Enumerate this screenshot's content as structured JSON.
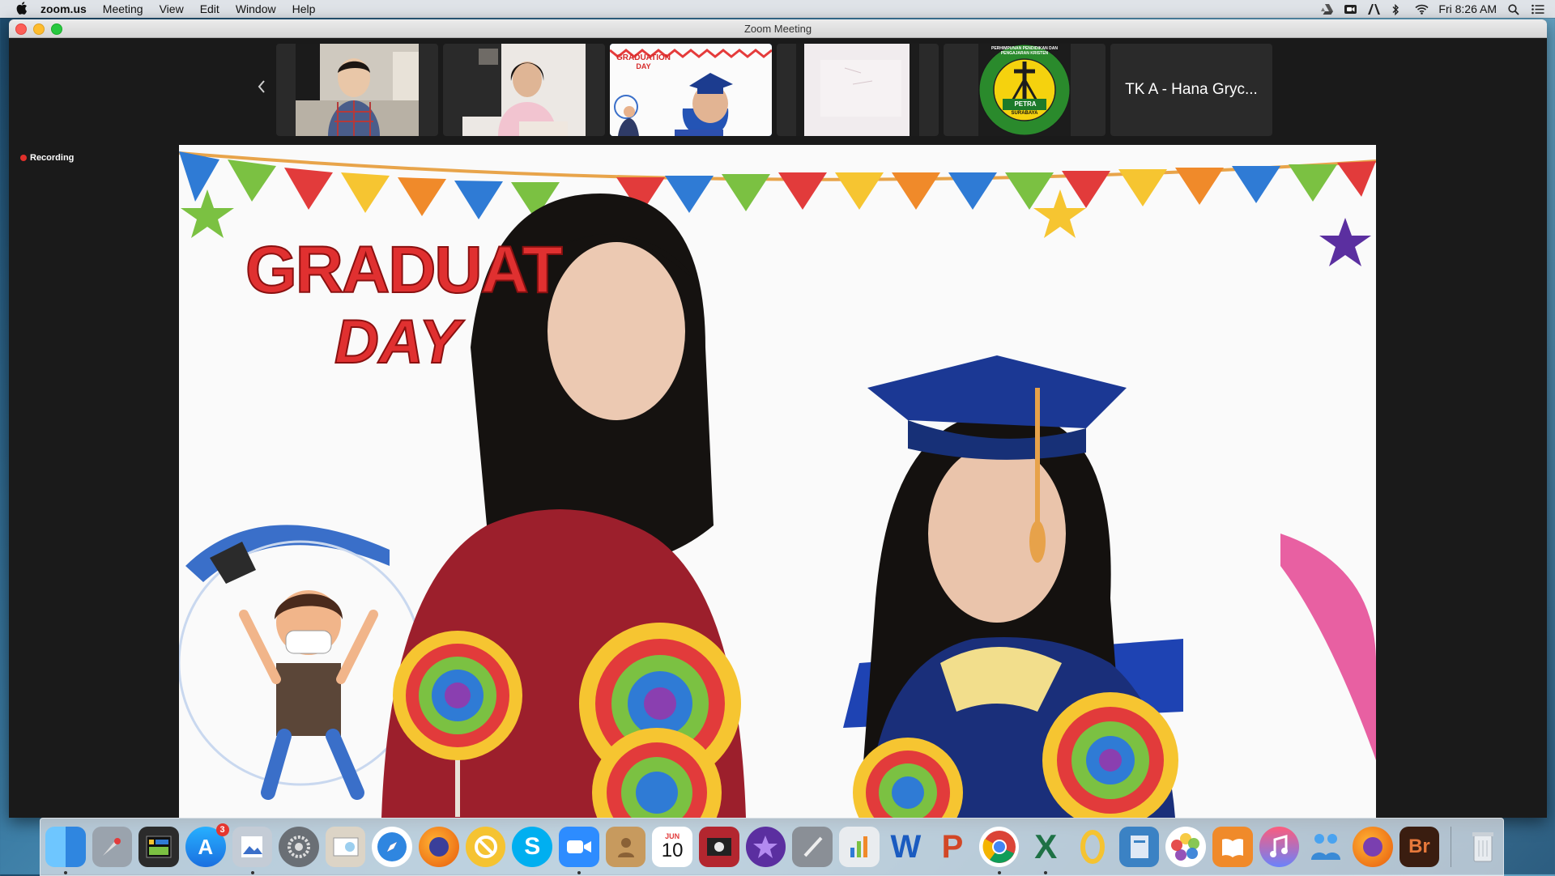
{
  "menubar": {
    "app_name": "zoom.us",
    "items": [
      "Meeting",
      "View",
      "Edit",
      "Window",
      "Help"
    ],
    "clock": "Fri 8:26 AM"
  },
  "window": {
    "title": "Zoom Meeting",
    "recording_label": "Recording"
  },
  "gallery": {
    "tiles": [
      {
        "type": "video",
        "scene": "child-plaid-shirt"
      },
      {
        "type": "video",
        "scene": "child-pink-shirt"
      },
      {
        "type": "video",
        "scene": "child-graduation-cap"
      },
      {
        "type": "video",
        "scene": "whiteboard"
      },
      {
        "type": "video",
        "scene": "school-logo"
      },
      {
        "type": "name",
        "label": "TK A - Hana Gryc..."
      }
    ],
    "logo_text_top": "PERHIMPUNAN PENDIDIKAN DAN PENGAJARAN KRISTEN",
    "logo_text_mid": "PETRA",
    "logo_text_bottom": "SURABAYA"
  },
  "main_video": {
    "banner_line1": "GRADUAT",
    "banner_line2": "DAY",
    "mini_banner_line1": "GRADUATION",
    "mini_banner_line2": "DAY"
  },
  "dock": {
    "calendar_month": "JUN",
    "calendar_day": "10",
    "appstore_badge": "3",
    "apps": [
      "finder",
      "launchpad",
      "activity",
      "app-store",
      "preview",
      "system-preferences",
      "photo-booth",
      "safari",
      "firefox",
      "no-entry",
      "skype",
      "zoom",
      "contacts",
      "calendar",
      "photo-booth-2",
      "imovie",
      "script-editor",
      "numbers",
      "word",
      "powerpoint",
      "chrome",
      "excel",
      "onedrive",
      "finder-2",
      "photos",
      "books",
      "itunes",
      "family",
      "firefox-2",
      "bridge",
      "trash"
    ]
  },
  "colors": {
    "zoom_blue": "#2d8cff",
    "record_red": "#e0302b"
  }
}
